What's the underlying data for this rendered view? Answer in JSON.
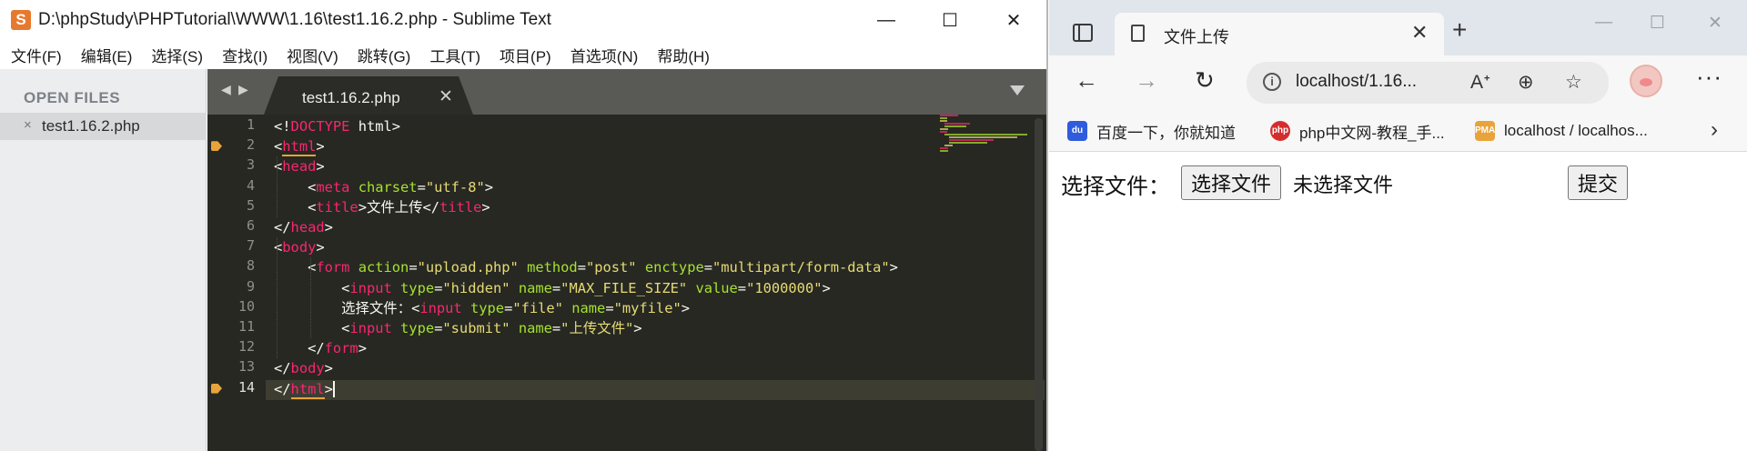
{
  "sublime": {
    "title": "D:\\phpStudy\\PHPTutorial\\WWW\\1.16\\test1.16.2.php - Sublime Text",
    "logo_glyph": "S",
    "window_controls": {
      "minimize": "—",
      "maximize": "☐",
      "close": "✕"
    },
    "menu": [
      "文件(F)",
      "编辑(E)",
      "选择(S)",
      "查找(I)",
      "视图(V)",
      "跳转(G)",
      "工具(T)",
      "项目(P)",
      "首选项(N)",
      "帮助(H)"
    ],
    "sidebar": {
      "header": "OPEN FILES",
      "file_close": "×",
      "file_name": "test1.16.2.php"
    },
    "tab": {
      "nav_left": "◀",
      "nav_right": "▶",
      "label": "test1.16.2.php",
      "close": "✕"
    },
    "line_numbers": [
      "1",
      "2",
      "3",
      "4",
      "5",
      "6",
      "7",
      "8",
      "9",
      "10",
      "11",
      "12",
      "13",
      "14"
    ],
    "current_line": "14",
    "code": [
      "<!DOCTYPE html>",
      "<html>",
      "<head>",
      "    <meta charset=\"utf-8\">",
      "    <title>文件上传</title>",
      "</head>",
      "<body>",
      "    <form action=\"upload.php\" method=\"post\" enctype=\"multipart/form-data\">",
      "        <input type=\"hidden\" name=\"MAX_FILE_SIZE\" value=\"1000000\">",
      "        选择文件：<input type=\"file\" name=\"myfile\">",
      "        <input type=\"submit\" name=\"上传文件\">",
      "    </form>",
      "</body>",
      "</html>"
    ],
    "colors": {
      "editor_bg": "#272822",
      "tag": "#f92672",
      "attr": "#a6e22e",
      "string": "#e6db74",
      "text": "#f8f8f2"
    }
  },
  "browser": {
    "tab_title": "文件上传",
    "tab_close": "✕",
    "new_tab": "+",
    "window_controls": {
      "minimize": "—",
      "maximize": "☐",
      "close": "✕"
    },
    "nav": {
      "back": "←",
      "forward": "→",
      "reload": "↻"
    },
    "address": {
      "info_icon": "i",
      "url": "localhost/1.16...",
      "read_aloud": "Aᐩ",
      "zoom": "⊕",
      "favorite": "☆"
    },
    "more": "···",
    "bookmarks": [
      {
        "icon": "baidu-icon",
        "label": "百度一下，你就知道",
        "color": "#2f5bdc"
      },
      {
        "icon": "php-cn-icon",
        "label": "php中文网-教程_手...",
        "color": "#d52d2d"
      },
      {
        "icon": "phpmyadmin-icon",
        "label": "localhost / localhos...",
        "color": "#e8a33a"
      }
    ],
    "bookmarks_more": "›",
    "page": {
      "label": "选择文件：",
      "file_button": "选择文件",
      "no_file_text": "未选择文件",
      "submit": "提交"
    }
  }
}
